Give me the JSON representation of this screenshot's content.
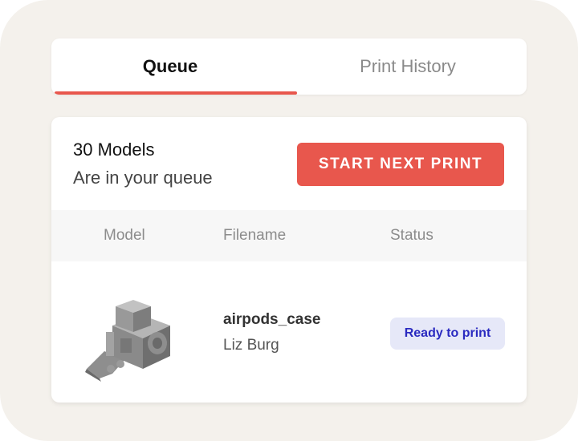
{
  "tabs": [
    {
      "label": "Queue",
      "active": true
    },
    {
      "label": "Print History",
      "active": false
    }
  ],
  "queue": {
    "count_label": "30 Models",
    "subtitle": "Are in your queue",
    "start_button": "START NEXT PRINT"
  },
  "table": {
    "headers": [
      "Model",
      "Filename",
      "Status"
    ],
    "rows": [
      {
        "model_icon": "3d-model-thumbnail-icon",
        "filename": "airpods_case",
        "owner": "Liz Burg",
        "status": "Ready to print"
      }
    ]
  },
  "colors": {
    "accent": "#e8574d",
    "background": "#f4f1ec",
    "status_badge_bg": "#e6e8f8",
    "status_badge_text": "#2a2ac0"
  }
}
